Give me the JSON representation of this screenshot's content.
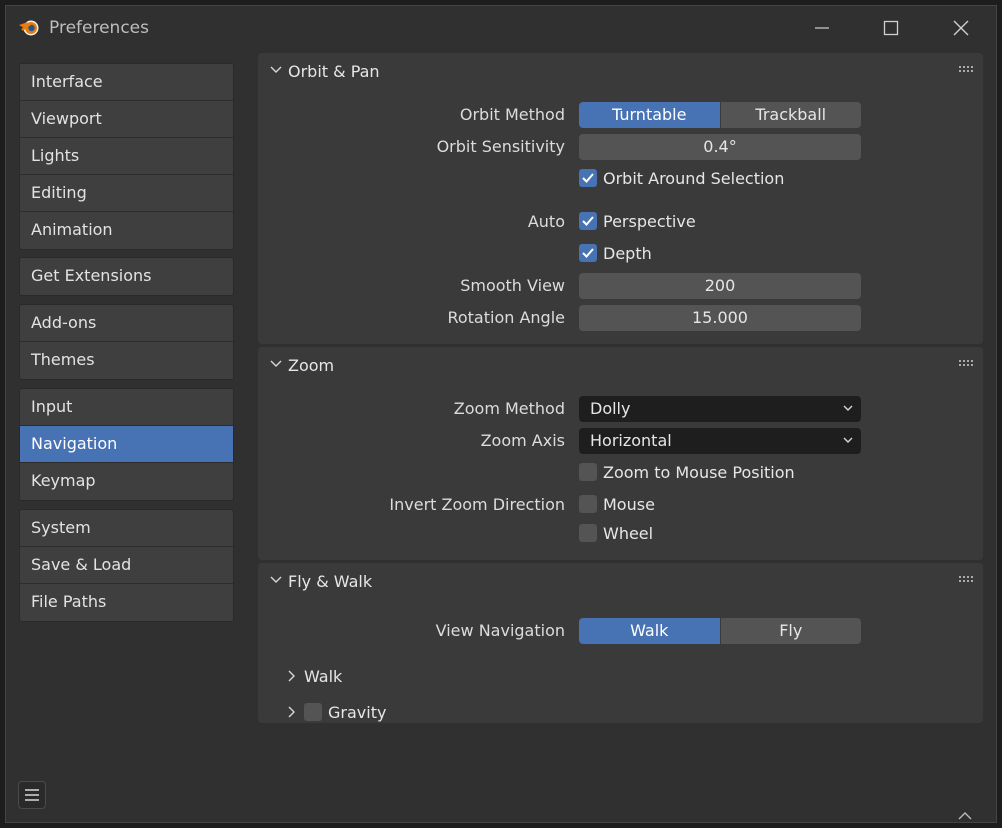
{
  "window": {
    "title": "Preferences"
  },
  "sidebar": {
    "groups": [
      [
        "Interface",
        "Viewport",
        "Lights",
        "Editing",
        "Animation"
      ],
      [
        "Get Extensions"
      ],
      [
        "Add-ons",
        "Themes"
      ],
      [
        "Input",
        "Navigation",
        "Keymap"
      ],
      [
        "System",
        "Save & Load",
        "File Paths"
      ]
    ],
    "active": "Navigation"
  },
  "orbit_pan": {
    "title": "Orbit & Pan",
    "orbit_method_label": "Orbit Method",
    "orbit_method_options": [
      "Turntable",
      "Trackball"
    ],
    "orbit_method_selected": "Turntable",
    "orbit_sensitivity_label": "Orbit Sensitivity",
    "orbit_sensitivity_value": "0.4°",
    "orbit_around_selection_label": "Orbit Around Selection",
    "orbit_around_selection_checked": true,
    "auto_label": "Auto",
    "perspective_label": "Perspective",
    "perspective_checked": true,
    "depth_label": "Depth",
    "depth_checked": true,
    "smooth_view_label": "Smooth View",
    "smooth_view_value": "200",
    "rotation_angle_label": "Rotation Angle",
    "rotation_angle_value": "15.000"
  },
  "zoom": {
    "title": "Zoom",
    "zoom_method_label": "Zoom Method",
    "zoom_method_value": "Dolly",
    "zoom_axis_label": "Zoom Axis",
    "zoom_axis_value": "Horizontal",
    "zoom_to_mouse_label": "Zoom to Mouse Position",
    "zoom_to_mouse_checked": false,
    "invert_label": "Invert Zoom Direction",
    "mouse_label": "Mouse",
    "mouse_checked": false,
    "wheel_label": "Wheel",
    "wheel_checked": false
  },
  "fly_walk": {
    "title": "Fly & Walk",
    "view_navigation_label": "View Navigation",
    "view_navigation_options": [
      "Walk",
      "Fly"
    ],
    "view_navigation_selected": "Walk",
    "walk_sub_label": "Walk",
    "gravity_sub_label": "Gravity",
    "gravity_checked": false
  },
  "colors": {
    "accent": "#4772b3",
    "panel_bg": "#3a3a3a",
    "window_bg": "#303030"
  }
}
